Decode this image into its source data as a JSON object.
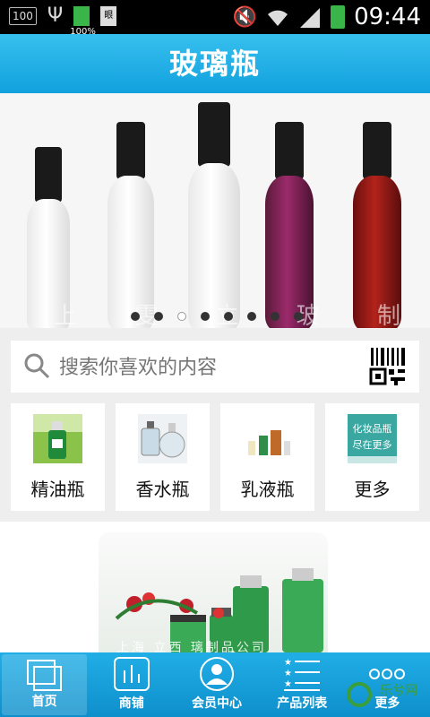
{
  "status_bar": {
    "left_badge": "100",
    "battery_label": "100%",
    "doc_label": "眼",
    "time": "09:44"
  },
  "header": {
    "title": "玻璃瓶"
  },
  "banner": {
    "watermark": "上 雯 立 玻 制 公 司",
    "dots": 8,
    "active_dot": 2
  },
  "search": {
    "placeholder": "搜索你喜欢的内容"
  },
  "categories": [
    {
      "label": "精油瓶"
    },
    {
      "label": "香水瓶"
    },
    {
      "label": "乳液瓶"
    },
    {
      "label": "更多",
      "image_text_1": "化妆品瓶",
      "image_text_2": "尽在更多"
    }
  ],
  "product": {
    "caption": "上海 立西 璃制品公司"
  },
  "bottom_nav": [
    {
      "label": "首页"
    },
    {
      "label": "商铺"
    },
    {
      "label": "会员中心"
    },
    {
      "label": "产品列表"
    },
    {
      "label": "更多"
    }
  ],
  "watermark_brand": "乐兮网",
  "colors": {
    "accent": "#12a1de",
    "nav": "#0e8fcb"
  }
}
